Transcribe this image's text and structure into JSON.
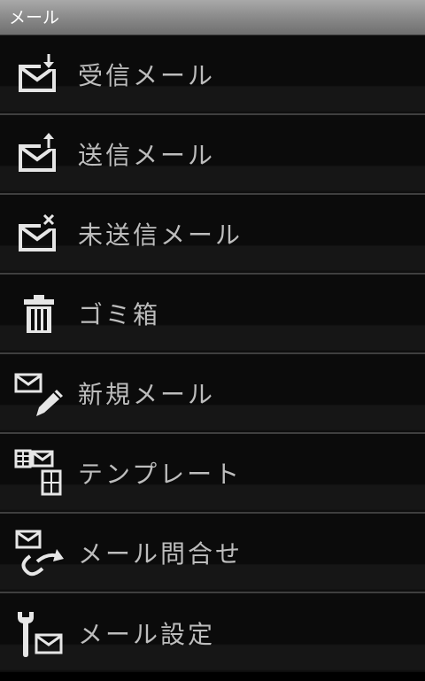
{
  "app": {
    "title": "メール"
  },
  "menu": {
    "items": [
      {
        "label": "受信メール",
        "icon": "inbox-mail-icon"
      },
      {
        "label": "送信メール",
        "icon": "sent-mail-icon"
      },
      {
        "label": "未送信メール",
        "icon": "unsent-mail-icon"
      },
      {
        "label": "ゴミ箱",
        "icon": "trash-icon"
      },
      {
        "label": "新規メール",
        "icon": "compose-mail-icon"
      },
      {
        "label": "テンプレート",
        "icon": "template-icon"
      },
      {
        "label": "メール問合せ",
        "icon": "mail-inquiry-icon"
      },
      {
        "label": "メール設定",
        "icon": "mail-settings-icon"
      }
    ]
  }
}
